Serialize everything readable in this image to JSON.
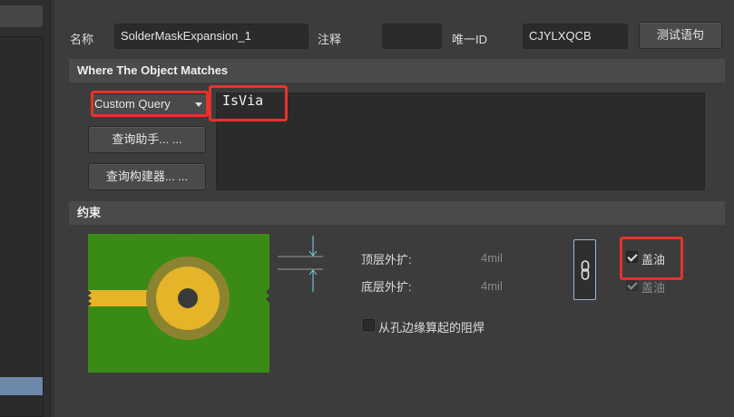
{
  "header": {
    "name_label": "名称",
    "name_value": "SolderMaskExpansion_1",
    "comment_label": "注释",
    "comment_value": "",
    "uid_label": "唯一ID",
    "uid_value": "CJYLXQCB",
    "test_button": "测试语句"
  },
  "where": {
    "title": "Where The Object Matches",
    "query_type": "Custom Query",
    "query_helper_button": "查询助手... ...",
    "query_builder_button": "查询构建器... ...",
    "query_text": "IsVia"
  },
  "constraints": {
    "title": "约束",
    "top_expansion_label": "顶层外扩:",
    "top_expansion_value": "4mil",
    "bottom_expansion_label": "底层外扩:",
    "bottom_expansion_value": "4mil",
    "tent_top_label": "盖油",
    "tent_top_checked": true,
    "tent_bottom_label": "盖油",
    "tent_bottom_checked": true,
    "from_hole_edge_label": "从孔边缘算起的阻焊",
    "from_hole_edge_checked": false
  },
  "colors": {
    "highlight_red": "#e8322c",
    "board_green": "#3a8a16",
    "pad_yellow": "#e6b428",
    "mask_olive": "#8c8330",
    "selection_blue": "#6d88a8"
  }
}
